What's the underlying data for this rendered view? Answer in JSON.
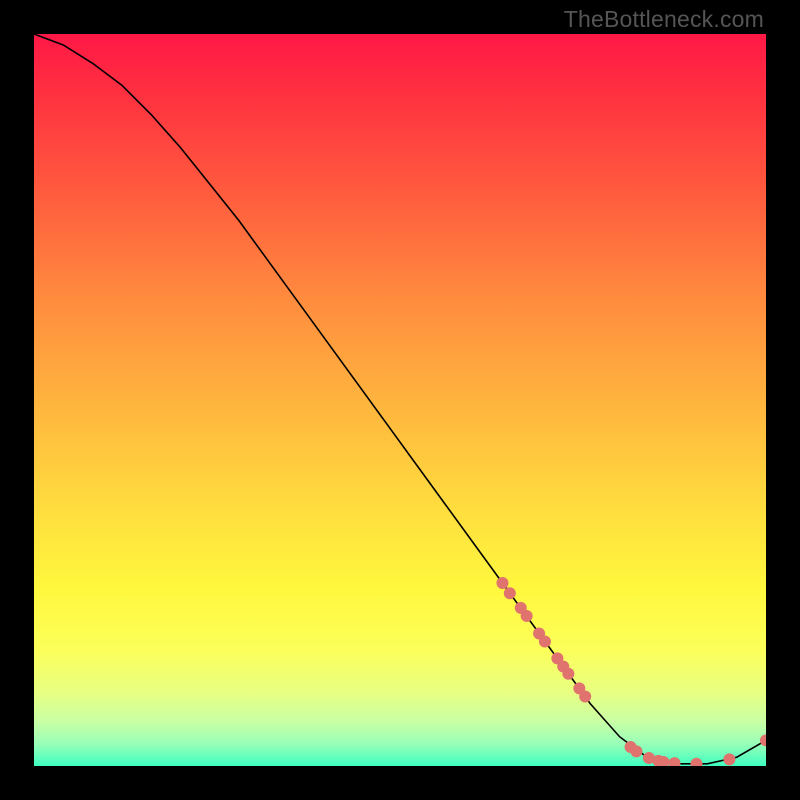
{
  "watermark": "TheBottleneck.com",
  "chart_data": {
    "type": "line",
    "title": "",
    "xlabel": "",
    "ylabel": "",
    "xlim": [
      0,
      100
    ],
    "ylim": [
      0,
      100
    ],
    "grid": false,
    "legend": false,
    "series": [
      {
        "name": "curve",
        "color": "#000000",
        "x": [
          0,
          4,
          8,
          12,
          16,
          20,
          24,
          28,
          32,
          36,
          40,
          44,
          48,
          52,
          56,
          60,
          64,
          68,
          72,
          76,
          80,
          84,
          88,
          92,
          96,
          100
        ],
        "y": [
          100,
          98.5,
          96,
          93,
          89,
          84.5,
          79.5,
          74.5,
          69,
          63.5,
          58,
          52.5,
          47,
          41.5,
          36,
          30.5,
          25,
          19.5,
          14,
          8.5,
          4,
          1,
          0.3,
          0.3,
          1.2,
          3.5
        ]
      }
    ],
    "markers": {
      "name": "points",
      "color": "#e0736e",
      "radius_px": 6,
      "x": [
        64,
        65,
        66.5,
        67.3,
        69,
        69.8,
        71.5,
        72.3,
        73,
        74.5,
        75.3,
        81.5,
        82.3,
        84,
        85.3,
        86,
        87.5,
        90.5,
        95,
        100
      ],
      "y": [
        25,
        23.6,
        21.6,
        20.5,
        18.1,
        17,
        14.7,
        13.6,
        12.6,
        10.6,
        9.5,
        2.6,
        2,
        1.1,
        0.7,
        0.55,
        0.4,
        0.3,
        0.9,
        3.5
      ]
    }
  }
}
